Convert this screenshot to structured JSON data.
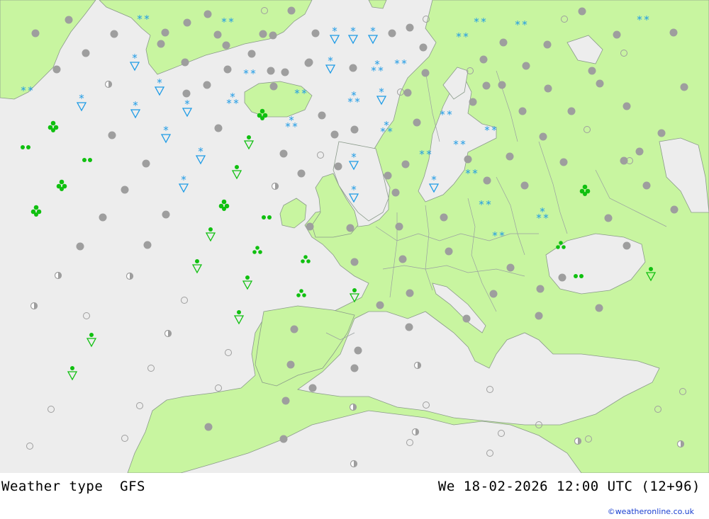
{
  "header": {
    "product": "Weather type",
    "model": "GFS",
    "valid_time": "We 18-02-2026 12:00 UTC (12+96)"
  },
  "credit": "©weatheronline.co.uk",
  "colors": {
    "sea": "#ededed",
    "land": "#c8f5a0",
    "border": "#9aa0a0",
    "cloud": "#9e9e9e",
    "snow": "#1e9be6",
    "rain": "#10c010"
  },
  "legend_symbols": [
    "cloud-dot",
    "partly-cloudy",
    "clear-circle",
    "snow-stars",
    "snow-shower",
    "rain-dots",
    "rain-showers",
    "rain-shower-triangle"
  ]
}
